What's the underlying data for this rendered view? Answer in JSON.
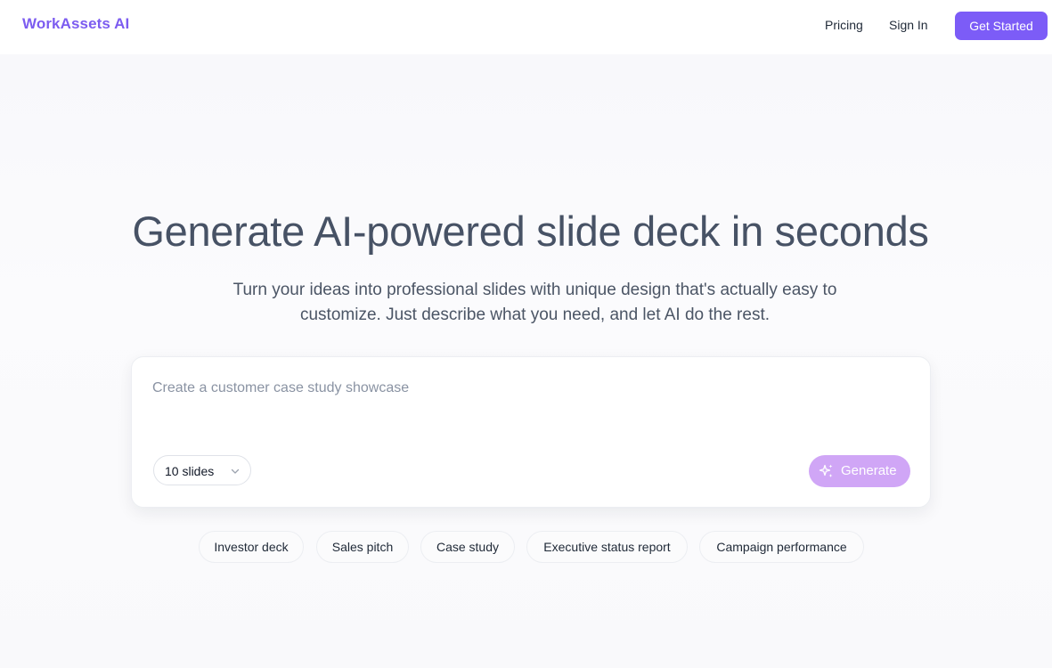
{
  "header": {
    "brand": "WorkAssets AI",
    "nav": {
      "pricing": "Pricing",
      "sign_in": "Sign In",
      "get_started": "Get Started"
    }
  },
  "hero": {
    "title": "Generate AI-powered slide deck in seconds",
    "subtitle": "Turn your ideas into professional slides with unique design that's actually easy to customize. Just describe what you need, and let AI do the rest."
  },
  "prompt": {
    "placeholder": "Create a customer case study showcase",
    "slide_count": "10 slides",
    "generate_label": "Generate"
  },
  "suggestions": [
    "Investor deck",
    "Sales pitch",
    "Case study",
    "Executive status report",
    "Campaign performance"
  ],
  "colors": {
    "brand": "#7c5cf0",
    "primary_button": "#7c5cf7",
    "generate_disabled": "#d0a6f6",
    "heading": "#475265",
    "background": "#f8f8fb"
  },
  "icons": {
    "dropdown": "chevron-down-icon",
    "generate": "sparkles-icon"
  }
}
